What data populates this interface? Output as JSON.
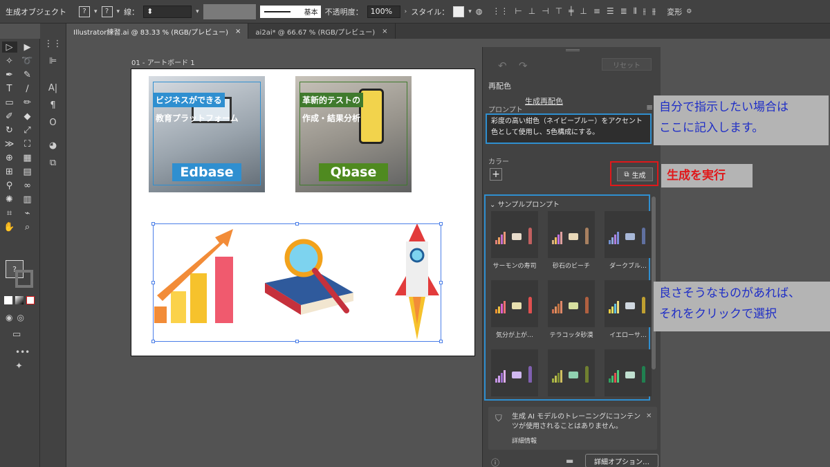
{
  "control_bar": {
    "selection_label": "生成オブジェクト",
    "fill_value": "?",
    "stroke_value": "?",
    "stroke_label": "線：",
    "stroke_profile": "基本",
    "opacity_label": "不透明度：",
    "opacity_value": "100%",
    "style_label": "スタイル：",
    "transform_label": "変形"
  },
  "tabs": [
    {
      "label": "Illustrator練習.ai @ 83.33 % (RGB/プレビュー)"
    },
    {
      "label": "ai2ai* @ 66.67 % (RGB/プレビュー)"
    }
  ],
  "artboard": {
    "label": "01 - アートボード 1",
    "thumb_edbase": {
      "caption1": "ビジネスができる",
      "caption2": "教育プラットフォーム",
      "brand": "Edbase"
    },
    "thumb_qbase": {
      "caption1": "革新的テストの",
      "caption2": "作成・結果分析",
      "brand": "Qbase"
    }
  },
  "panel": {
    "reset_label": "リセット",
    "tab_recolor": "再配色",
    "tab_gen_recolor": "生成再配色",
    "prompt_label": "プロンプト",
    "prompt_text": "彩度の高い紺色（ネイビーブルー）をアクセント色として使用し、5色構成にする。",
    "color_label": "カラー",
    "generate_label": "生成",
    "sample_title": "サンプルプロンプト",
    "samples": [
      {
        "label": "サーモンの寿司"
      },
      {
        "label": "砂石のビーチ"
      },
      {
        "label": "ダークブル…"
      },
      {
        "label": "気分が上が…"
      },
      {
        "label": "テラコッタ砂漠"
      },
      {
        "label": "イエローサ…"
      },
      {
        "label": ""
      },
      {
        "label": ""
      },
      {
        "label": ""
      }
    ],
    "notice_text": "生成 AI モデルのトレーニングにコンテンツが使用されることはありません。",
    "notice_link": "詳細情報",
    "more_options": "詳細オプション…"
  },
  "callouts": {
    "instruction": [
      "自分で指示したい場合は",
      "ここに記入します。"
    ],
    "generate": "生成を実行",
    "sample": [
      "良さそうなものがあれば、",
      "それをクリックで選択"
    ]
  },
  "colors": {
    "accent_blue": "#2f8fd0",
    "accent_red": "#e0181a",
    "callout_text": "#1f2ec6"
  }
}
